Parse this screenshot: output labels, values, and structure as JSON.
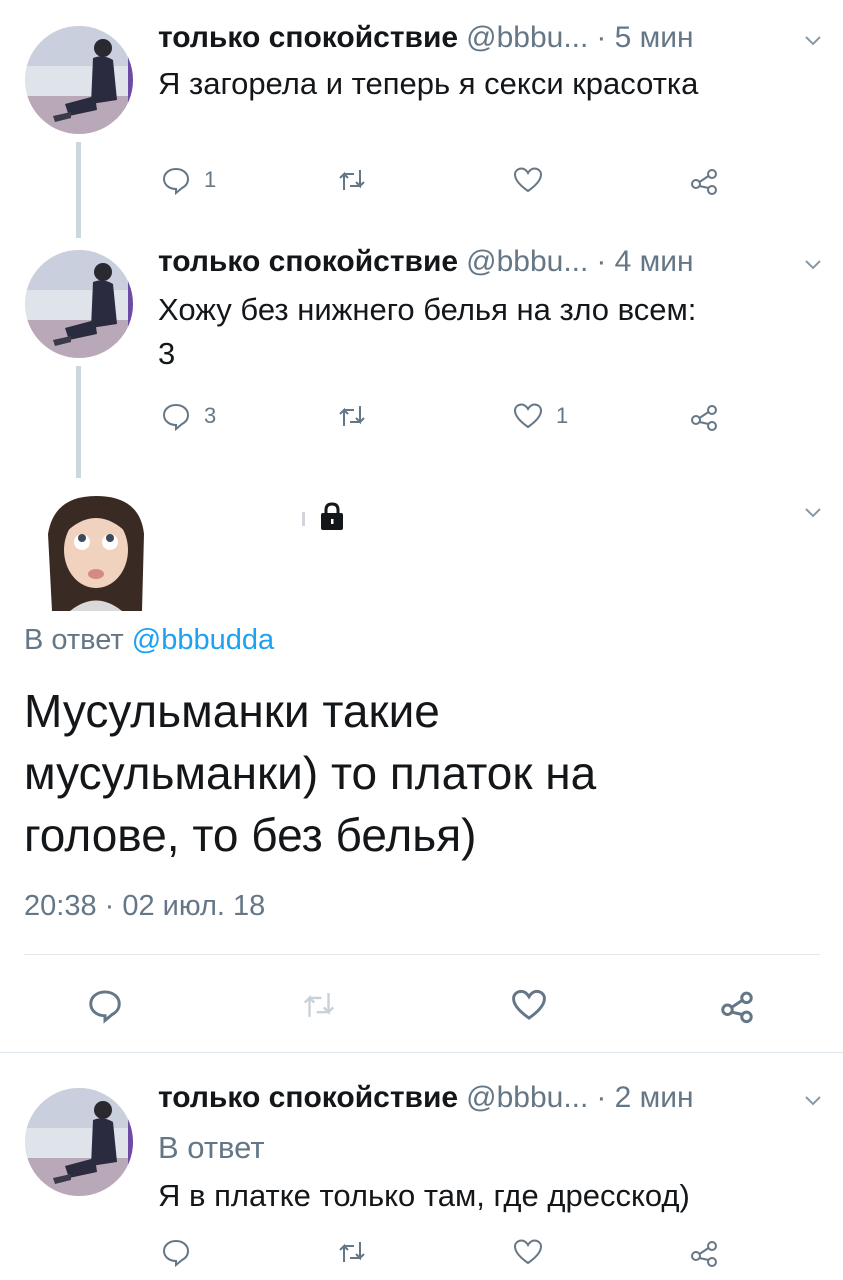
{
  "tweets": [
    {
      "name": "только спокойствие",
      "handle": "@bbbu...",
      "time": "· 5 мин",
      "text": "Я загорела и теперь я секси красотка",
      "replies": "1",
      "retweets": "",
      "likes": ""
    },
    {
      "name": "только спокойствие",
      "handle": "@bbbu...",
      "time": "· 4 мин",
      "text_line1": "Хожу без нижнего белья на зло всем:",
      "text_line2": "3",
      "replies": "3",
      "retweets": "",
      "likes": "1"
    }
  ],
  "focused": {
    "reply_prefix": "В ответ",
    "reply_to": "@bbbudda",
    "text_line1": "Мусульманки такие",
    "text_line2": "мусульманки) то платок на",
    "text_line3": "голове, то без белья)",
    "date": "20:38 · 02 июл. 18"
  },
  "reply_tweet": {
    "name": "только спокойствие",
    "handle": "@bbbu...",
    "time": "· 2 мин",
    "reply_prefix": "В ответ",
    "text": "Я в платке только там, где дресскод)"
  },
  "colors": {
    "accent": "#1da1f2",
    "secondary_text": "#657786",
    "thread_line": "#ccd6dd",
    "divider": "#e1e8ed"
  },
  "icons": [
    "reply-icon",
    "retweet-icon",
    "like-icon",
    "share-icon",
    "chevron-down-icon",
    "lock-icon"
  ]
}
